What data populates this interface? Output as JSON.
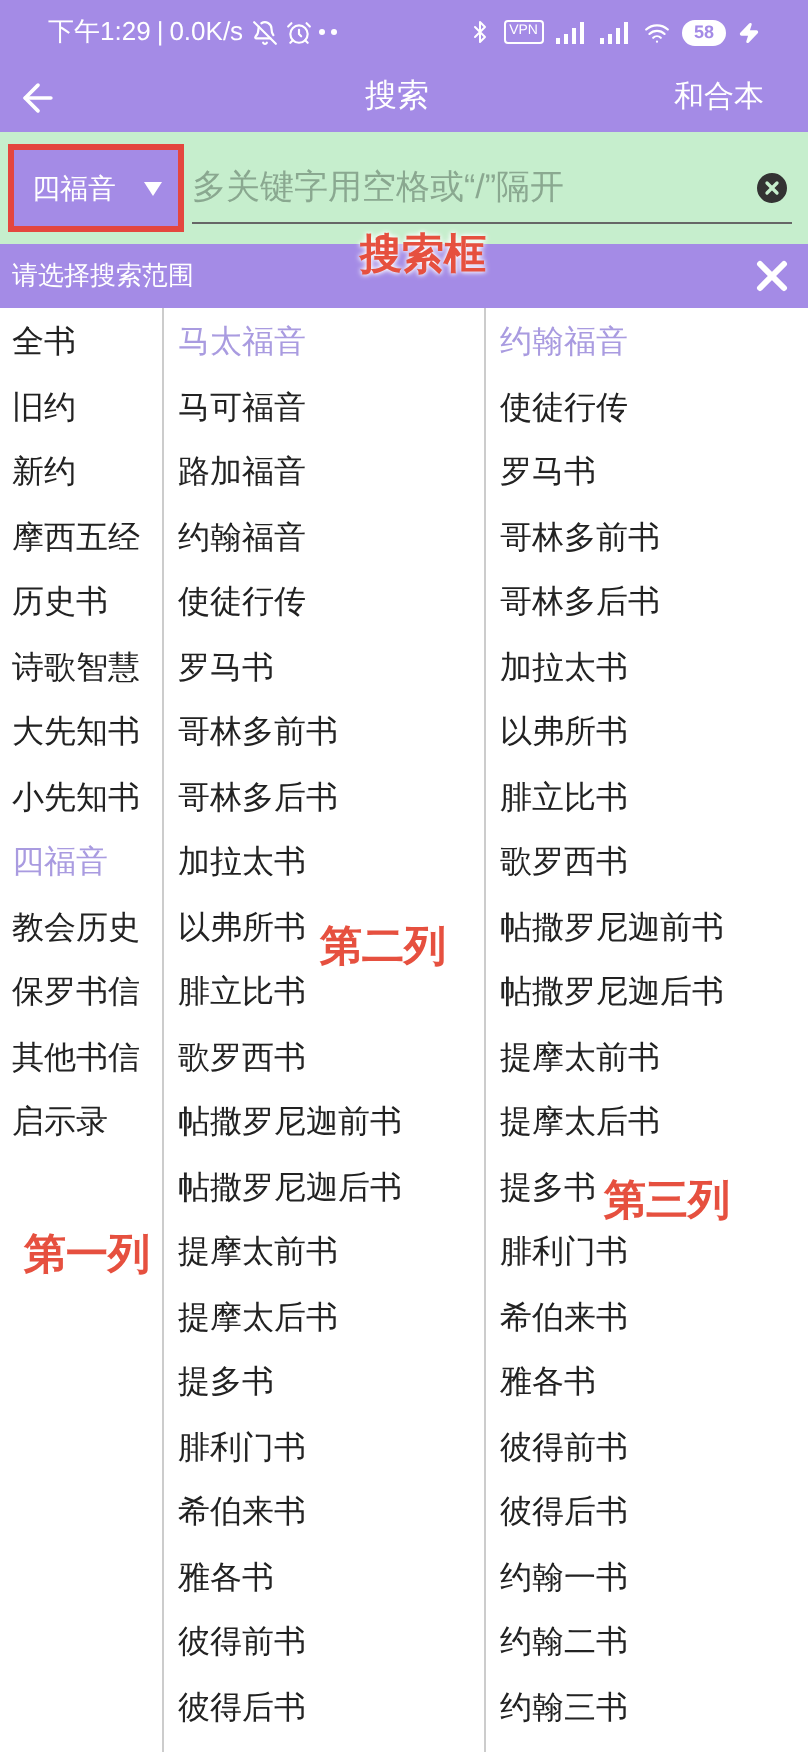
{
  "status_bar": {
    "time": "下午1:29",
    "separator": "|",
    "speed": "0.0K/s",
    "vpn": "VPN",
    "battery": "58"
  },
  "toolbar": {
    "title": "搜索",
    "action": "和合本"
  },
  "search": {
    "scope": "四福音",
    "scope_highlighted": true,
    "placeholder": "多关键字用空格或“/”隔开"
  },
  "scope_bar": {
    "title": "请选择搜索范围"
  },
  "column_1": [
    {
      "label": "全书",
      "selected": false
    },
    {
      "label": "旧约",
      "selected": false
    },
    {
      "label": "新约",
      "selected": false
    },
    {
      "label": "摩西五经",
      "selected": false
    },
    {
      "label": "历史书",
      "selected": false
    },
    {
      "label": "诗歌智慧",
      "selected": false
    },
    {
      "label": "大先知书",
      "selected": false
    },
    {
      "label": "小先知书",
      "selected": false
    },
    {
      "label": "四福音",
      "selected": true
    },
    {
      "label": "教会历史",
      "selected": false
    },
    {
      "label": "保罗书信",
      "selected": false
    },
    {
      "label": "其他书信",
      "selected": false
    },
    {
      "label": "启示录",
      "selected": false
    }
  ],
  "column_2": [
    {
      "label": "马太福音",
      "selected": true
    },
    {
      "label": "马可福音",
      "selected": false
    },
    {
      "label": "路加福音",
      "selected": false
    },
    {
      "label": "约翰福音",
      "selected": false
    },
    {
      "label": "使徒行传",
      "selected": false
    },
    {
      "label": "罗马书",
      "selected": false
    },
    {
      "label": "哥林多前书",
      "selected": false
    },
    {
      "label": "哥林多后书",
      "selected": false
    },
    {
      "label": "加拉太书",
      "selected": false
    },
    {
      "label": "以弗所书",
      "selected": false
    },
    {
      "label": "腓立比书",
      "selected": false
    },
    {
      "label": "歌罗西书",
      "selected": false
    },
    {
      "label": "帖撒罗尼迦前书",
      "selected": false
    },
    {
      "label": "帖撒罗尼迦后书",
      "selected": false
    },
    {
      "label": "提摩太前书",
      "selected": false
    },
    {
      "label": "提摩太后书",
      "selected": false
    },
    {
      "label": "提多书",
      "selected": false
    },
    {
      "label": "腓利门书",
      "selected": false
    },
    {
      "label": "希伯来书",
      "selected": false
    },
    {
      "label": "雅各书",
      "selected": false
    },
    {
      "label": "彼得前书",
      "selected": false
    },
    {
      "label": "彼得后书",
      "selected": false
    }
  ],
  "column_3": [
    {
      "label": "约翰福音",
      "selected": true
    },
    {
      "label": "使徒行传",
      "selected": false
    },
    {
      "label": "罗马书",
      "selected": false
    },
    {
      "label": "哥林多前书",
      "selected": false
    },
    {
      "label": "哥林多后书",
      "selected": false
    },
    {
      "label": "加拉太书",
      "selected": false
    },
    {
      "label": "以弗所书",
      "selected": false
    },
    {
      "label": "腓立比书",
      "selected": false
    },
    {
      "label": "歌罗西书",
      "selected": false
    },
    {
      "label": "帖撒罗尼迦前书",
      "selected": false
    },
    {
      "label": "帖撒罗尼迦后书",
      "selected": false
    },
    {
      "label": "提摩太前书",
      "selected": false
    },
    {
      "label": "提摩太后书",
      "selected": false
    },
    {
      "label": "提多书",
      "selected": false
    },
    {
      "label": "腓利门书",
      "selected": false
    },
    {
      "label": "希伯来书",
      "selected": false
    },
    {
      "label": "雅各书",
      "selected": false
    },
    {
      "label": "彼得前书",
      "selected": false
    },
    {
      "label": "彼得后书",
      "selected": false
    },
    {
      "label": "约翰一书",
      "selected": false
    },
    {
      "label": "约翰二书",
      "selected": false
    },
    {
      "label": "约翰三书",
      "selected": false
    }
  ],
  "annotations": [
    "搜索框",
    "第一列",
    "第二列",
    "第三列"
  ]
}
